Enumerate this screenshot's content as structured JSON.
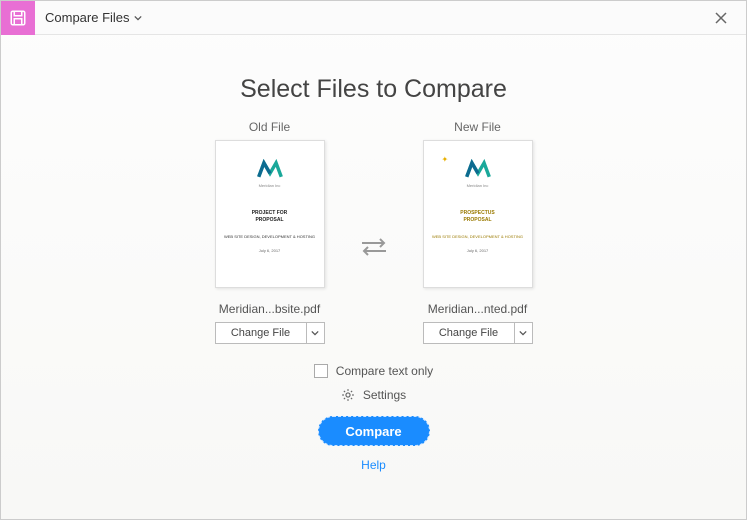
{
  "titlebar": {
    "title": "Compare Files"
  },
  "heading": "Select Files to Compare",
  "oldFile": {
    "label": "Old File",
    "filename": "Meridian...bsite.pdf",
    "changeLabel": "Change File"
  },
  "newFile": {
    "label": "New File",
    "filename": "Meridian...nted.pdf",
    "changeLabel": "Change File"
  },
  "options": {
    "compareTextOnly": "Compare text only",
    "settings": "Settings"
  },
  "buttons": {
    "compare": "Compare",
    "help": "Help"
  }
}
